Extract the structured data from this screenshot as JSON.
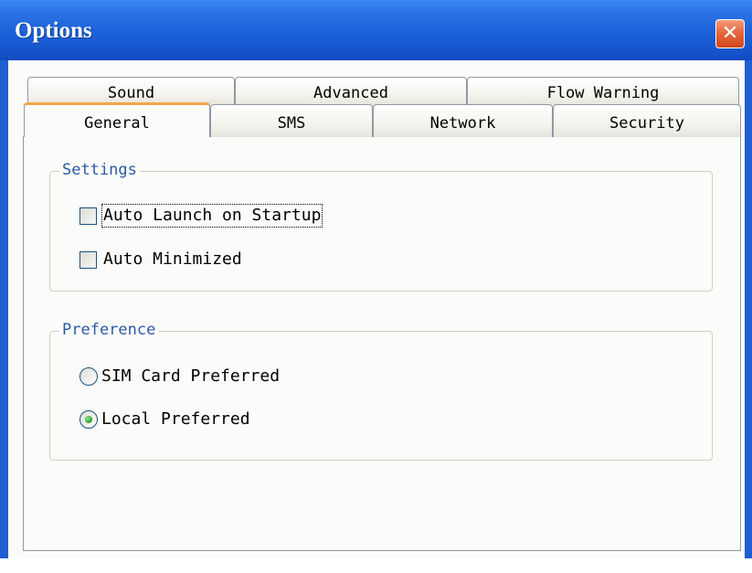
{
  "window": {
    "title": "Options",
    "close_glyph": "✕"
  },
  "tabs": {
    "row1": [
      {
        "label": "Sound"
      },
      {
        "label": "Advanced"
      },
      {
        "label": "Flow Warning"
      }
    ],
    "row2": [
      {
        "label": "General",
        "active": true
      },
      {
        "label": "SMS"
      },
      {
        "label": "Network"
      },
      {
        "label": "Security"
      }
    ]
  },
  "settings": {
    "label": "Settings",
    "options": [
      {
        "label": "Auto Launch on Startup",
        "checked": false
      },
      {
        "label": "Auto Minimized",
        "checked": false
      }
    ]
  },
  "preference": {
    "label": "Preference",
    "options": [
      {
        "label": "SIM Card Preferred",
        "selected": false
      },
      {
        "label": "Local Preferred",
        "selected": true
      }
    ]
  },
  "colors": {
    "title_bar": "#1c60d8",
    "close_button": "#e6683e",
    "active_tab_accent": "#f2a54a",
    "group_label": "#2a5aa8",
    "radio_selected": "#2faa2a"
  }
}
